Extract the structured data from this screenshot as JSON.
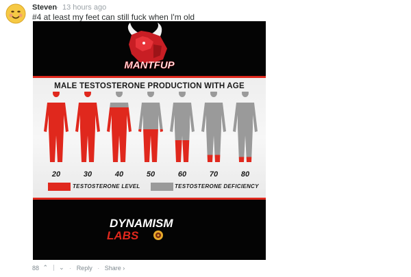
{
  "comment": {
    "author": "Steven",
    "separator": "·",
    "timestamp": "13 hours ago",
    "text": "#4 at least my feet can still fuck when I'm old",
    "avatar_icon": "smiley-face-avatar"
  },
  "meme": {
    "top_logo_text": "MANTFUP",
    "chart_title": "MALE TESTOSTERONE PRODUCTION WITH AGE",
    "legend": {
      "level_label": "TESTOSTERONE LEVEL",
      "deficiency_label": "TESTOSTERONE DEFICIENCY"
    },
    "colors": {
      "level": "#e0281d",
      "deficiency": "#9a9a9a",
      "background": "#040404"
    },
    "bottom_logo_line1": "DYNAMISM",
    "bottom_logo_line2": "LABS",
    "chart_data": {
      "type": "bar",
      "title": "MALE TESTOSTERONE PRODUCTION WITH AGE",
      "categories": [
        "20",
        "30",
        "40",
        "50",
        "60",
        "70",
        "80"
      ],
      "series": [
        {
          "name": "TESTOSTERONE LEVEL",
          "values": [
            1.0,
            1.0,
            0.75,
            0.45,
            0.3,
            0.1,
            0.07
          ]
        },
        {
          "name": "TESTOSTERONE DEFICIENCY",
          "values": [
            0.0,
            0.0,
            0.25,
            0.55,
            0.7,
            0.9,
            0.93
          ]
        }
      ],
      "xlabel": "",
      "ylabel": "",
      "legend": "bottom"
    }
  },
  "actions": {
    "upvotes": "88",
    "upvote_icon": "chevron-up-icon",
    "downvote_icon": "chevron-down-icon",
    "reply_label": "Reply",
    "share_label": "Share ›",
    "dot": "·"
  }
}
